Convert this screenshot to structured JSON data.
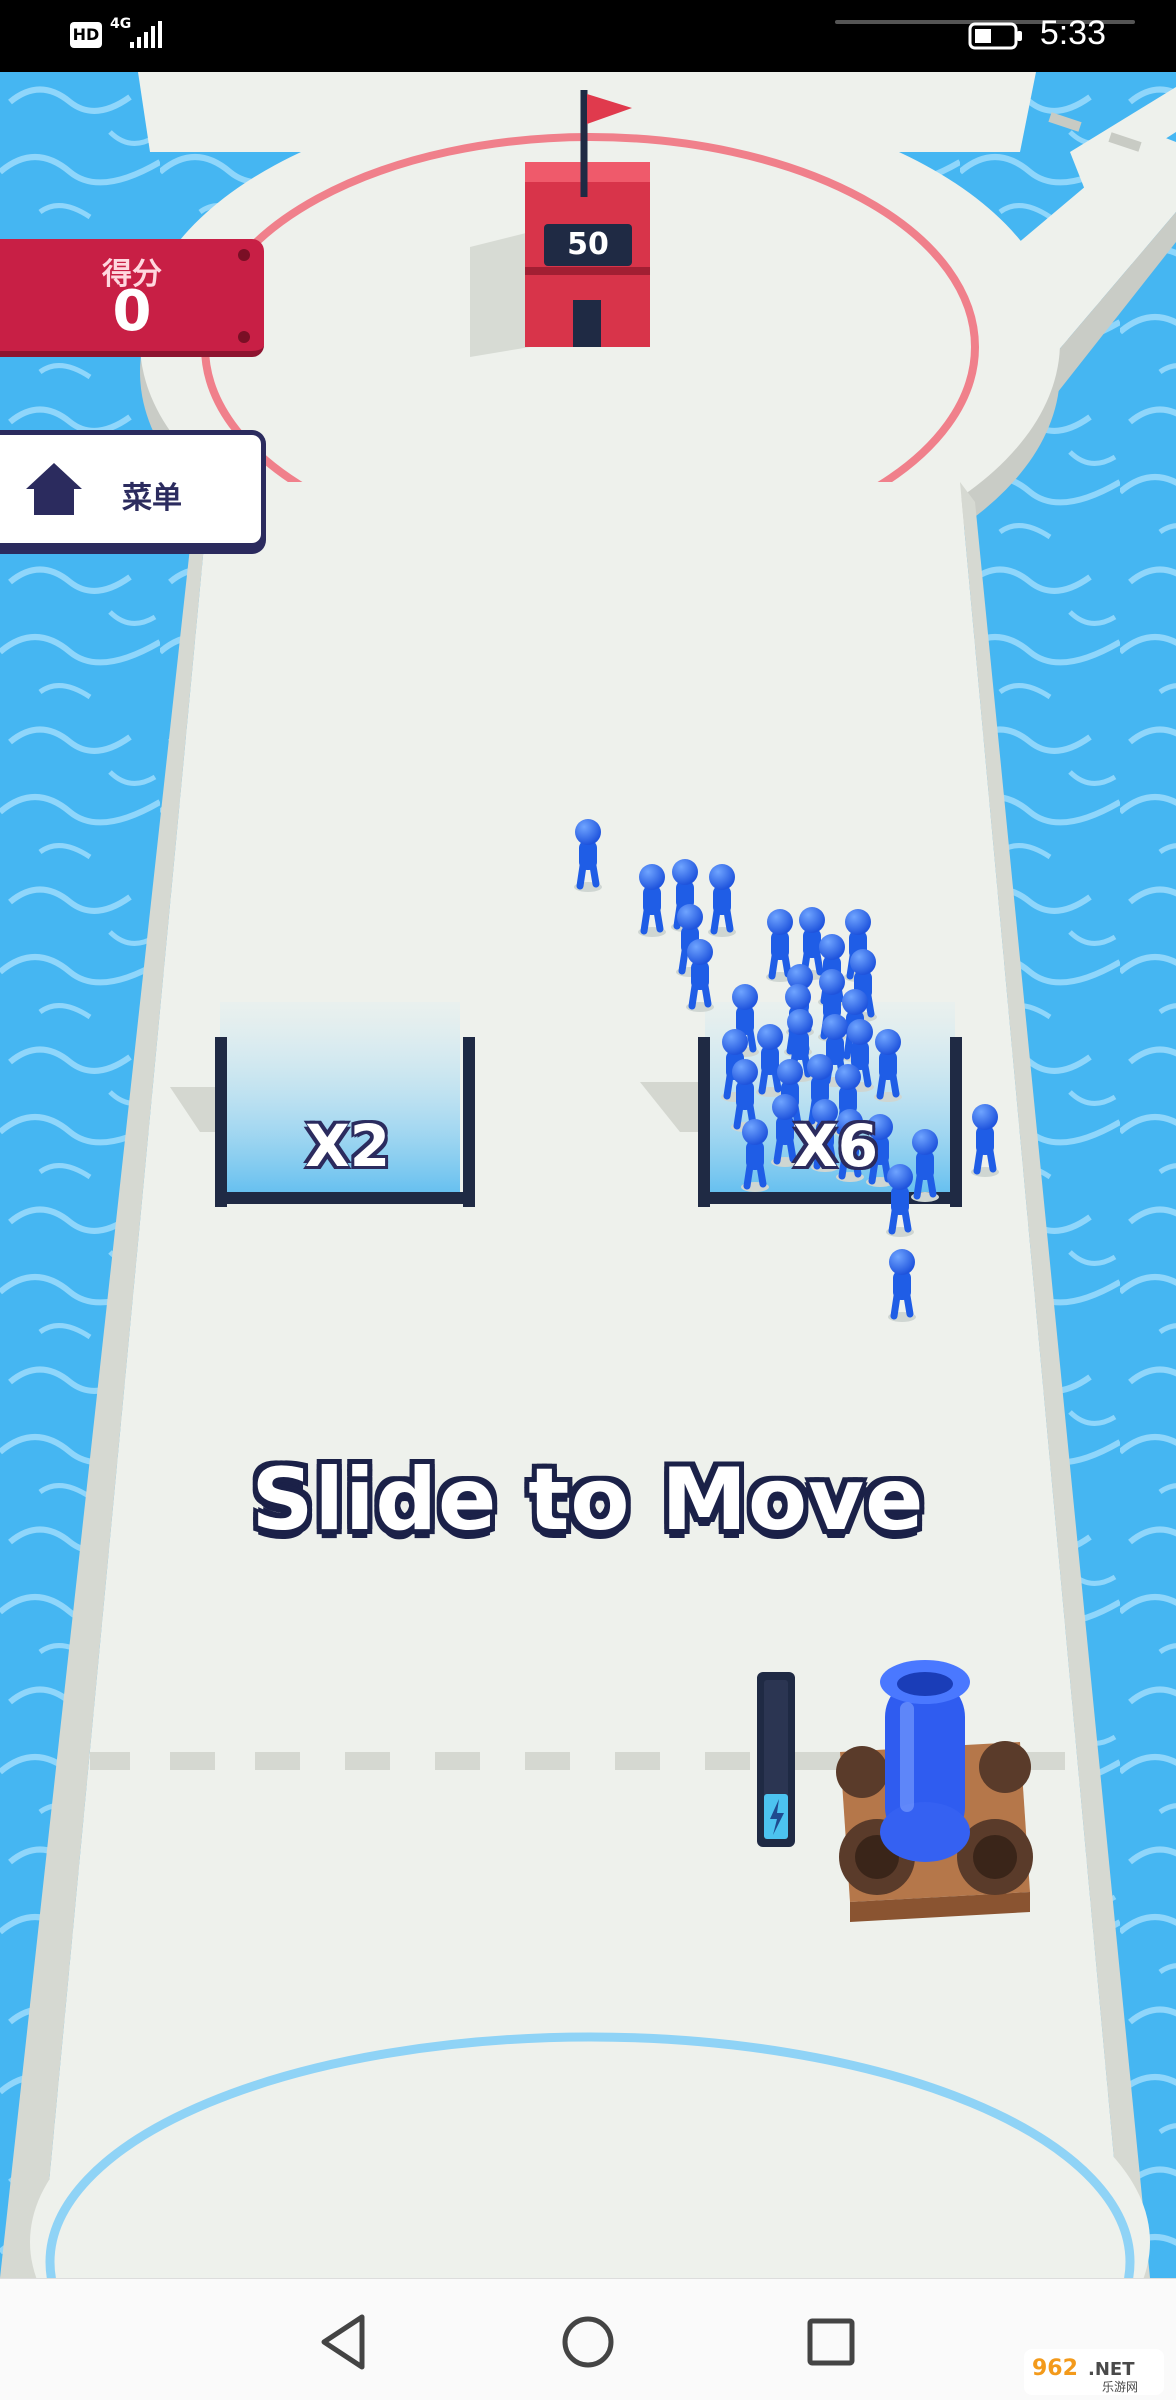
{
  "status_bar": {
    "hd_badge": "HD",
    "network": "4G",
    "time": "5:33"
  },
  "hud": {
    "score_label": "得分",
    "score_value": "0",
    "menu_label": "菜单"
  },
  "scene": {
    "tower_count": "50",
    "gates": [
      {
        "label": "X2"
      },
      {
        "label": "X6"
      }
    ],
    "crowd_color": "#1f5de6",
    "cannon_color": "#2f5cf0",
    "water_color": "#49b8f2",
    "road_color": "#eef1ec",
    "hint": "Slide to Move",
    "cannon_charge": 0.3
  },
  "watermark": {
    "text": "962.NET",
    "subtext": "乐游网"
  },
  "icons": {
    "home": "home-icon",
    "back": "back-triangle-icon",
    "home_nav": "home-circle-icon",
    "recents": "recents-square-icon",
    "flag": "flag-icon",
    "battery": "battery-icon",
    "signal": "signal-icon",
    "energy": "lightning-icon"
  }
}
